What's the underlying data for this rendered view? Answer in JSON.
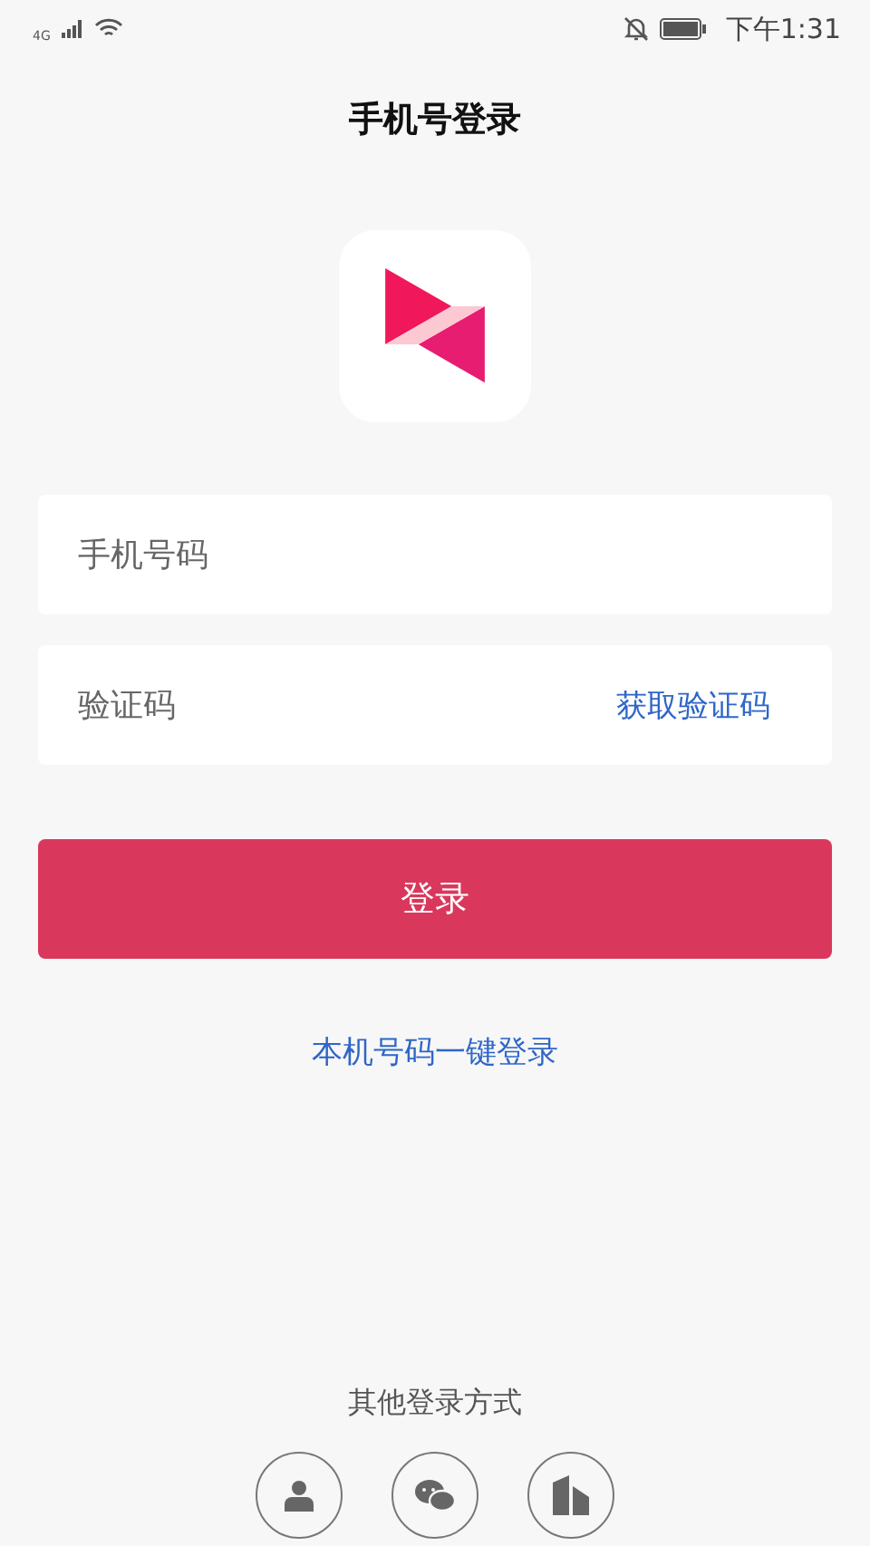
{
  "status_bar": {
    "network": "4G",
    "time": "下午1:31"
  },
  "title": "手机号登录",
  "phone_field": {
    "placeholder": "手机号码"
  },
  "code_field": {
    "placeholder": "验证码",
    "action": "获取验证码"
  },
  "login_button": "登录",
  "one_tap_login": "本机号码一键登录",
  "other_methods": {
    "label": "其他登录方式",
    "options": [
      {
        "kind": "account"
      },
      {
        "kind": "wechat"
      },
      {
        "kind": "building"
      }
    ]
  }
}
